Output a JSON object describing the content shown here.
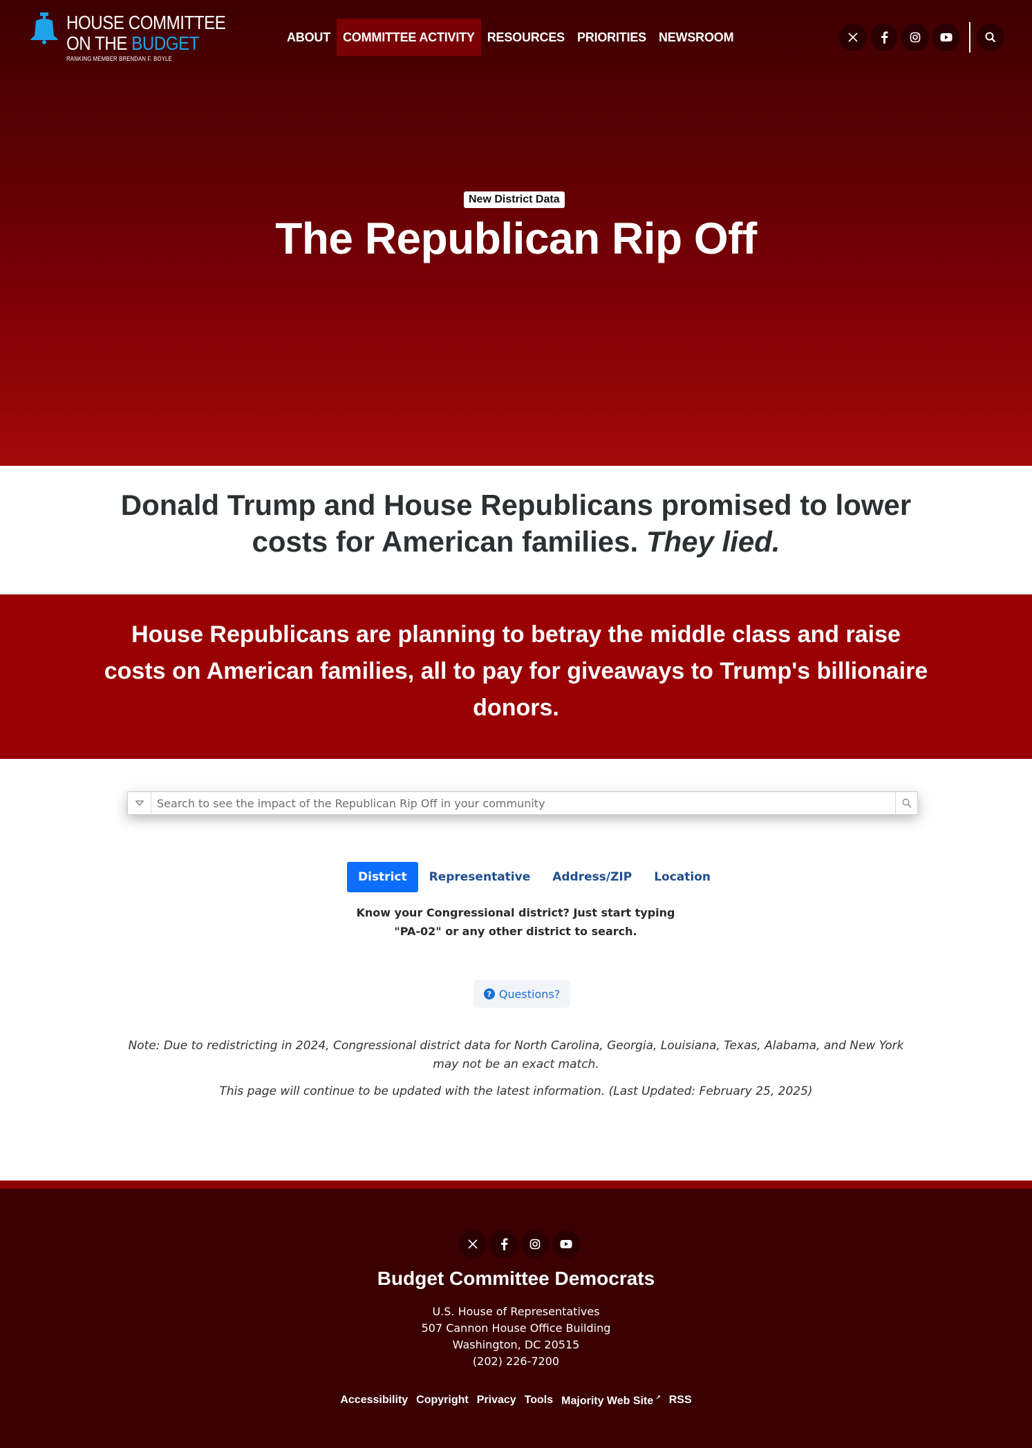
{
  "logo": {
    "line1": "HOUSE COMMITTEE",
    "line2_prefix": "ON THE ",
    "line2_blue": "BUDGET",
    "subline": "RANKING MEMBER BRENDAN F. BOYLE"
  },
  "nav": {
    "items": [
      {
        "label": "ABOUT"
      },
      {
        "label": "COMMITTEE ACTIVITY"
      },
      {
        "label": "RESOURCES"
      },
      {
        "label": "PRIORITIES"
      },
      {
        "label": "NEWSROOM"
      }
    ]
  },
  "hero": {
    "badge": "New District Data",
    "title": "The Republican Rip Off"
  },
  "lied": {
    "text": "Donald Trump and House Republicans promised to lower costs for American families. ",
    "emphasis": "They lied."
  },
  "band": {
    "text": "House Republicans are planning to betray the middle class and raise costs on American families, all to pay for giveaways to Trump's billionaire donors."
  },
  "search": {
    "placeholder": "Search to see the impact of the Republican Rip Off in your community"
  },
  "tabs": [
    {
      "label": "District"
    },
    {
      "label": "Representative"
    },
    {
      "label": "Address/ZIP"
    },
    {
      "label": "Location"
    }
  ],
  "hint": "Know your Congressional district? Just start typing \"PA-02\" or any other district to search.",
  "questions": {
    "label": "Questions?"
  },
  "note": "Note: Due to redistricting in 2024, Congressional district data for North Carolina, Georgia, Louisiana, Texas, Alabama, and New York may not be an exact match.",
  "updated": "This page will continue to be updated with the latest information. (Last Updated: February 25, 2025)",
  "footer": {
    "title": "Budget Committee Democrats",
    "address": [
      "U.S. House of Representatives",
      "507 Cannon House Office Building",
      "Washington, DC 20515",
      "(202) 226-7200"
    ],
    "links": [
      {
        "label": "Accessibility"
      },
      {
        "label": "Copyright"
      },
      {
        "label": "Privacy"
      },
      {
        "label": "Tools"
      },
      {
        "label": "Majority Web Site"
      },
      {
        "label": "RSS"
      }
    ]
  },
  "social_icons": [
    "x-icon",
    "facebook-icon",
    "instagram-icon",
    "youtube-icon"
  ],
  "colors": {
    "hero_dark": "#3d0002",
    "hero_red": "#a30a0a",
    "band_red": "#9a0103",
    "tab_active": "#0d6efd",
    "logo_blue": "#1fa3e8",
    "footer": "#3a0002"
  }
}
